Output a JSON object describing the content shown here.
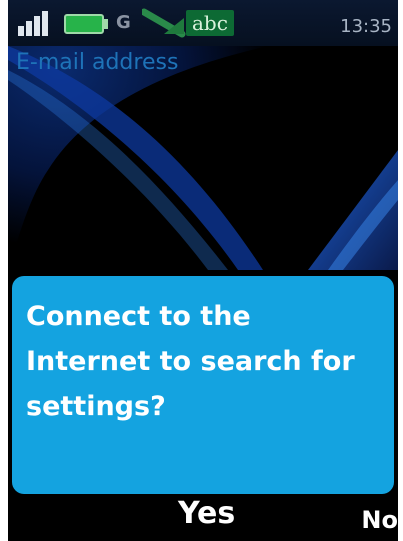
{
  "status_bar": {
    "network_type": "G",
    "input_mode": "abc",
    "time": "13:35",
    "signal_icon": "signal-strength-icon",
    "battery_icon": "battery-icon",
    "connection_icon": "data-connection-icon"
  },
  "background": {
    "field_label": "E-mail address"
  },
  "dialog": {
    "message": "Connect to the Internet to search for settings?"
  },
  "softkeys": {
    "yes_label": "Yes",
    "no_label": "No"
  },
  "colors": {
    "dialog_background": "#14a3e0",
    "field_label": "#1e73b8",
    "battery": "#27b34a",
    "input_mode_background": "#0d6a34"
  }
}
